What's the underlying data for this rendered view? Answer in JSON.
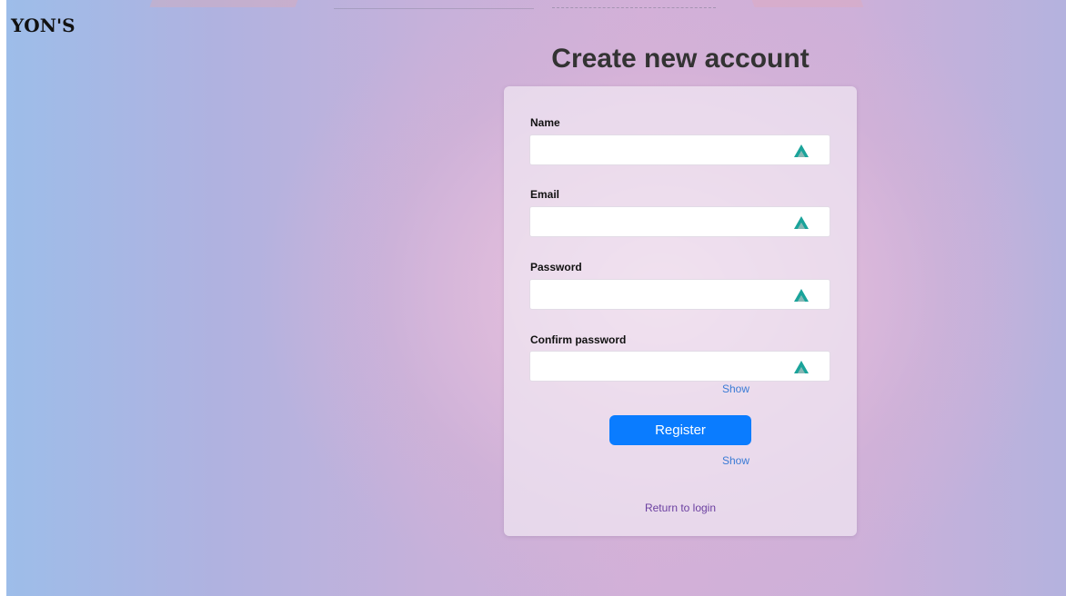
{
  "brand": {
    "logo_text": "YON'S"
  },
  "page": {
    "title": "Create new account"
  },
  "form": {
    "fields": [
      {
        "label": "Name",
        "value": "",
        "placeholder": ""
      },
      {
        "label": "Email",
        "value": "",
        "placeholder": ""
      },
      {
        "label": "Password",
        "value": "",
        "placeholder": ""
      },
      {
        "label": "Confirm password",
        "value": "",
        "placeholder": ""
      }
    ],
    "show_password_label": "Show",
    "show_confirm_label": "Show",
    "register_label": "Register",
    "return_label": "Return to login"
  },
  "icons": {
    "field_autofill": "password-manager-icon"
  },
  "colors": {
    "accent": "#0a7cff",
    "link": "#3a7bd5",
    "return_link": "#6b3fa0",
    "icon_teal": "#1aa39a"
  }
}
